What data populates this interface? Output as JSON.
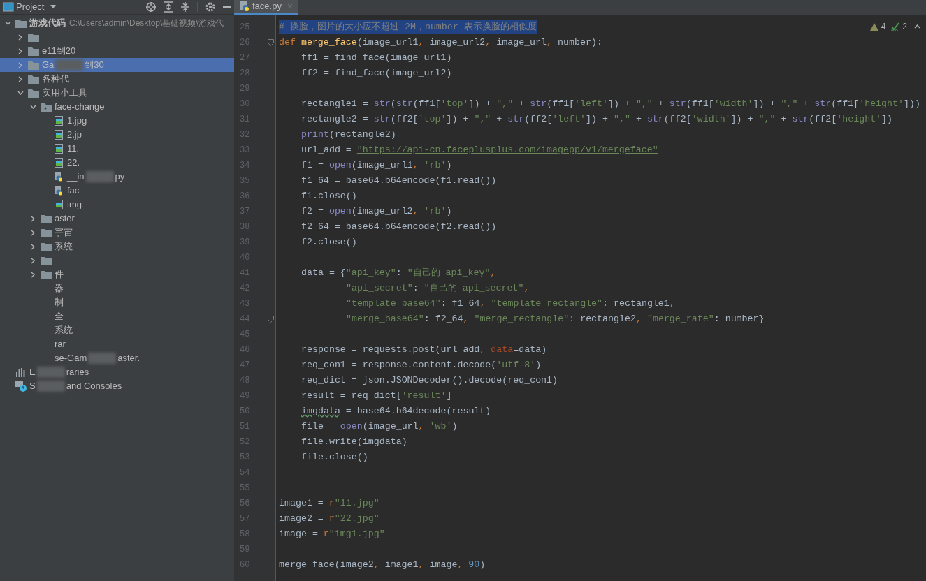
{
  "sidebar": {
    "title": "Project",
    "tree": [
      {
        "kind": "folder",
        "expanded": true,
        "selected": false,
        "parts": [
          "游戏代码"
        ],
        "path": "C:\\Users\\admin\\Desktop\\基础视频\\游戏代",
        "children": [
          {
            "kind": "folder",
            "expanded": false,
            "selected": false
          },
          {
            "kind": "folder",
            "expanded": false,
            "selected": false,
            "parts": [
              "e11到20"
            ]
          },
          {
            "kind": "folder",
            "expanded": false,
            "selected": true,
            "parts": [
              "Ga",
              "到30"
            ]
          },
          {
            "kind": "folder",
            "expanded": false,
            "selected": false,
            "parts": [
              "各种代"
            ]
          },
          {
            "kind": "folder",
            "expanded": true,
            "selected": false,
            "parts": [
              "实用小工具"
            ],
            "children": [
              {
                "kind": "module",
                "expanded": true,
                "selected": false,
                "parts": [
                  "face-change"
                ],
                "children": [
                  {
                    "kind": "image",
                    "selected": false,
                    "parts": [
                      "1.jpg"
                    ]
                  },
                  {
                    "kind": "image",
                    "selected": false,
                    "parts": [
                      "2.jp"
                    ]
                  },
                  {
                    "kind": "image",
                    "selected": false,
                    "parts": [
                      "11."
                    ]
                  },
                  {
                    "kind": "image",
                    "selected": false,
                    "parts": [
                      "22."
                    ]
                  },
                  {
                    "kind": "python",
                    "selected": false,
                    "parts": [
                      "__in",
                      "py"
                    ]
                  },
                  {
                    "kind": "python",
                    "selected": false,
                    "parts": [
                      "fac"
                    ]
                  },
                  {
                    "kind": "image",
                    "selected": false,
                    "parts": [
                      "img"
                    ]
                  }
                ]
              },
              {
                "kind": "folder",
                "expanded": false,
                "selected": false,
                "parts": [
                  "aster"
                ]
              },
              {
                "kind": "folder",
                "expanded": false,
                "selected": false,
                "parts": [
                  "宇宙"
                ]
              },
              {
                "kind": "folder",
                "expanded": false,
                "selected": false,
                "parts": [
                  "系统"
                ]
              },
              {
                "kind": "folder",
                "expanded": false,
                "selected": false
              },
              {
                "kind": "folder",
                "expanded": false,
                "selected": false,
                "parts": [
                  "件"
                ]
              },
              {
                "kind": "plain",
                "selected": false,
                "parts": [
                  "器"
                ]
              },
              {
                "kind": "plain",
                "selected": false,
                "parts": [
                  "制"
                ]
              },
              {
                "kind": "plain",
                "selected": false,
                "parts": [
                  "全"
                ]
              },
              {
                "kind": "plain",
                "selected": false,
                "parts": [
                  "系统"
                ]
              },
              {
                "kind": "plain",
                "selected": false,
                "parts": [
                  "rar"
                ]
              },
              {
                "kind": "plain",
                "selected": false,
                "parts": [
                  "se-Gam",
                  "aster."
                ]
              }
            ]
          }
        ]
      },
      {
        "kind": "libraries",
        "selected": false,
        "parts": [
          "E",
          "raries"
        ]
      },
      {
        "kind": "scratches",
        "selected": false,
        "parts": [
          "S",
          "and Consoles"
        ]
      }
    ]
  },
  "tab": {
    "label": "face.py"
  },
  "inspections": {
    "warnings": "4",
    "typos": "2"
  },
  "code": [
    {
      "number": "25",
      "kind": "top",
      "selected": true,
      "tokens": [
        {
          "kind": "comment",
          "text": "# 换脸，图片的大小应不超过 2M，number 表示换脸的相似度"
        }
      ]
    },
    {
      "number": "26",
      "kind": "top",
      "fold_marker": true,
      "tokens": [
        {
          "kind": "kw",
          "text": "def "
        },
        {
          "kind": "fn",
          "text": "merge_face"
        },
        {
          "kind": "plain",
          "text": "(image_url1"
        },
        {
          "kind": "kw",
          "text": ", "
        },
        {
          "kind": "plain",
          "text": "image_url2"
        },
        {
          "kind": "kw",
          "text": ", "
        },
        {
          "kind": "plain",
          "text": "image_url"
        },
        {
          "kind": "kw",
          "text": ", "
        },
        {
          "kind": "plain",
          "text": "number):"
        }
      ]
    },
    {
      "number": "27",
      "kind": "body",
      "tokens": [
        {
          "kind": "plain",
          "text": "ff1 = find_face(image_url1)"
        }
      ]
    },
    {
      "number": "28",
      "kind": "body",
      "tokens": [
        {
          "kind": "plain",
          "text": "ff2 = find_face(image_url2)"
        }
      ]
    },
    {
      "number": "29",
      "kind": "top"
    },
    {
      "number": "30",
      "kind": "body",
      "tokens": [
        {
          "kind": "plain",
          "text": "rectangle1 = "
        },
        {
          "kind": "builtin",
          "text": "str"
        },
        {
          "kind": "plain",
          "text": "("
        },
        {
          "kind": "builtin",
          "text": "str"
        },
        {
          "kind": "plain",
          "text": "(ff1["
        },
        {
          "kind": "str",
          "text": "'top'"
        },
        {
          "kind": "plain",
          "text": "]) + "
        },
        {
          "kind": "str",
          "text": "\",\""
        },
        {
          "kind": "plain",
          "text": " + "
        },
        {
          "kind": "builtin",
          "text": "str"
        },
        {
          "kind": "plain",
          "text": "(ff1["
        },
        {
          "kind": "str",
          "text": "'left'"
        },
        {
          "kind": "plain",
          "text": "]) + "
        },
        {
          "kind": "str",
          "text": "\",\""
        },
        {
          "kind": "plain",
          "text": " + "
        },
        {
          "kind": "builtin",
          "text": "str"
        },
        {
          "kind": "plain",
          "text": "(ff1["
        },
        {
          "kind": "str",
          "text": "'width'"
        },
        {
          "kind": "plain",
          "text": "]) + "
        },
        {
          "kind": "str",
          "text": "\",\""
        },
        {
          "kind": "plain",
          "text": " + "
        },
        {
          "kind": "builtin",
          "text": "str"
        },
        {
          "kind": "plain",
          "text": "(ff1["
        },
        {
          "kind": "str",
          "text": "'height'"
        },
        {
          "kind": "plain",
          "text": "]))"
        }
      ]
    },
    {
      "number": "31",
      "kind": "body",
      "tokens": [
        {
          "kind": "plain",
          "text": "rectangle2 = "
        },
        {
          "kind": "builtin",
          "text": "str"
        },
        {
          "kind": "plain",
          "text": "(ff2["
        },
        {
          "kind": "str",
          "text": "'top'"
        },
        {
          "kind": "plain",
          "text": "]) + "
        },
        {
          "kind": "str",
          "text": "\",\""
        },
        {
          "kind": "plain",
          "text": " + "
        },
        {
          "kind": "builtin",
          "text": "str"
        },
        {
          "kind": "plain",
          "text": "(ff2["
        },
        {
          "kind": "str",
          "text": "'left'"
        },
        {
          "kind": "plain",
          "text": "]) + "
        },
        {
          "kind": "str",
          "text": "\",\""
        },
        {
          "kind": "plain",
          "text": " + "
        },
        {
          "kind": "builtin",
          "text": "str"
        },
        {
          "kind": "plain",
          "text": "(ff2["
        },
        {
          "kind": "str",
          "text": "'width'"
        },
        {
          "kind": "plain",
          "text": "]) + "
        },
        {
          "kind": "str",
          "text": "\",\""
        },
        {
          "kind": "plain",
          "text": " + "
        },
        {
          "kind": "builtin",
          "text": "str"
        },
        {
          "kind": "plain",
          "text": "(ff2["
        },
        {
          "kind": "str",
          "text": "'height'"
        },
        {
          "kind": "plain",
          "text": "])"
        }
      ]
    },
    {
      "number": "32",
      "kind": "body",
      "tokens": [
        {
          "kind": "builtin",
          "text": "print"
        },
        {
          "kind": "plain",
          "text": "(rectangle2)"
        }
      ]
    },
    {
      "number": "33",
      "kind": "body",
      "tokens": [
        {
          "kind": "plain",
          "text": "url_add = "
        },
        {
          "kind": "url",
          "text": "\"https://api-cn.faceplusplus.com/imagepp/v1/mergeface\""
        }
      ]
    },
    {
      "number": "34",
      "kind": "body",
      "tokens": [
        {
          "kind": "plain",
          "text": "f1 = "
        },
        {
          "kind": "builtin",
          "text": "open"
        },
        {
          "kind": "plain",
          "text": "(image_url1"
        },
        {
          "kind": "kw",
          "text": ", "
        },
        {
          "kind": "str",
          "text": "'rb'"
        },
        {
          "kind": "plain",
          "text": ")"
        }
      ]
    },
    {
      "number": "35",
      "kind": "body",
      "tokens": [
        {
          "kind": "plain",
          "text": "f1_64 = base64.b64encode(f1.read())"
        }
      ]
    },
    {
      "number": "36",
      "kind": "body",
      "tokens": [
        {
          "kind": "plain",
          "text": "f1.close()"
        }
      ]
    },
    {
      "number": "37",
      "kind": "body",
      "tokens": [
        {
          "kind": "plain",
          "text": "f2 = "
        },
        {
          "kind": "builtin",
          "text": "open"
        },
        {
          "kind": "plain",
          "text": "(image_url2"
        },
        {
          "kind": "kw",
          "text": ", "
        },
        {
          "kind": "str",
          "text": "'rb'"
        },
        {
          "kind": "plain",
          "text": ")"
        }
      ]
    },
    {
      "number": "38",
      "kind": "body",
      "tokens": [
        {
          "kind": "plain",
          "text": "f2_64 = base64.b64encode(f2.read())"
        }
      ]
    },
    {
      "number": "39",
      "kind": "body",
      "tokens": [
        {
          "kind": "plain",
          "text": "f2.close()"
        }
      ]
    },
    {
      "number": "40",
      "kind": "top"
    },
    {
      "number": "41",
      "kind": "body",
      "tokens": [
        {
          "kind": "plain",
          "text": "data = {"
        },
        {
          "kind": "str",
          "text": "\"api_key\""
        },
        {
          "kind": "plain",
          "text": ": "
        },
        {
          "kind": "str",
          "text": "\"自己的 api_key\""
        },
        {
          "kind": "kw",
          "text": ","
        }
      ]
    },
    {
      "number": "42",
      "kind": "cont",
      "tokens": [
        {
          "kind": "str",
          "text": "\"api_secret\""
        },
        {
          "kind": "plain",
          "text": ": "
        },
        {
          "kind": "str",
          "text": "\"自己的 api_secret\""
        },
        {
          "kind": "kw",
          "text": ","
        }
      ]
    },
    {
      "number": "43",
      "kind": "cont",
      "tokens": [
        {
          "kind": "str",
          "text": "\"template_base64\""
        },
        {
          "kind": "plain",
          "text": ": f1_64"
        },
        {
          "kind": "kw",
          "text": ", "
        },
        {
          "kind": "str",
          "text": "\"template_rectangle\""
        },
        {
          "kind": "plain",
          "text": ": rectangle1"
        },
        {
          "kind": "kw",
          "text": ","
        }
      ]
    },
    {
      "number": "44",
      "kind": "cont",
      "fold_marker": true,
      "tokens": [
        {
          "kind": "str",
          "text": "\"merge_base64\""
        },
        {
          "kind": "plain",
          "text": ": f2_64"
        },
        {
          "kind": "kw",
          "text": ", "
        },
        {
          "kind": "str",
          "text": "\"merge_rectangle\""
        },
        {
          "kind": "plain",
          "text": ": rectangle2"
        },
        {
          "kind": "kw",
          "text": ", "
        },
        {
          "kind": "str",
          "text": "\"merge_rate\""
        },
        {
          "kind": "plain",
          "text": ": number}"
        }
      ]
    },
    {
      "number": "45",
      "kind": "top"
    },
    {
      "number": "46",
      "kind": "body",
      "tokens": [
        {
          "kind": "plain",
          "text": "response = requests.post(url_add"
        },
        {
          "kind": "kw",
          "text": ", "
        },
        {
          "kind": "param",
          "text": "data"
        },
        {
          "kind": "plain",
          "text": "=data)"
        }
      ]
    },
    {
      "number": "47",
      "kind": "body",
      "tokens": [
        {
          "kind": "plain",
          "text": "req_con1 = response.content.decode("
        },
        {
          "kind": "str",
          "text": "'utf-8'"
        },
        {
          "kind": "plain",
          "text": ")"
        }
      ]
    },
    {
      "number": "48",
      "kind": "body",
      "tokens": [
        {
          "kind": "plain",
          "text": "req_dict = json.JSONDecoder().decode(req_con1)"
        }
      ]
    },
    {
      "number": "49",
      "kind": "body",
      "tokens": [
        {
          "kind": "plain",
          "text": "result = req_dict["
        },
        {
          "kind": "str",
          "text": "'result'"
        },
        {
          "kind": "plain",
          "text": "]"
        }
      ]
    },
    {
      "number": "50",
      "kind": "body",
      "tokens": [
        {
          "kind": "typo",
          "text": "imgdata"
        },
        {
          "kind": "plain",
          "text": " = base64.b64decode(result)"
        }
      ]
    },
    {
      "number": "51",
      "kind": "body",
      "tokens": [
        {
          "kind": "plain",
          "text": "file = "
        },
        {
          "kind": "builtin",
          "text": "open"
        },
        {
          "kind": "plain",
          "text": "(image_url"
        },
        {
          "kind": "kw",
          "text": ", "
        },
        {
          "kind": "str",
          "text": "'wb'"
        },
        {
          "kind": "plain",
          "text": ")"
        }
      ]
    },
    {
      "number": "52",
      "kind": "body",
      "tokens": [
        {
          "kind": "plain",
          "text": "file.write(imgdata)"
        }
      ]
    },
    {
      "number": "53",
      "kind": "body",
      "tokens": [
        {
          "kind": "plain",
          "text": "file.close()"
        }
      ]
    },
    {
      "number": "54",
      "kind": "top"
    },
    {
      "number": "55",
      "kind": "top"
    },
    {
      "number": "56",
      "kind": "top",
      "tokens": [
        {
          "kind": "plain",
          "text": "image1 = "
        },
        {
          "kind": "kw",
          "text": "r"
        },
        {
          "kind": "str",
          "text": "\"11.jpg\""
        }
      ]
    },
    {
      "number": "57",
      "kind": "top",
      "tokens": [
        {
          "kind": "plain",
          "text": "image2 = "
        },
        {
          "kind": "kw",
          "text": "r"
        },
        {
          "kind": "str",
          "text": "\"22.jpg\""
        }
      ]
    },
    {
      "number": "58",
      "kind": "top",
      "tokens": [
        {
          "kind": "plain",
          "text": "image = "
        },
        {
          "kind": "kw",
          "text": "r"
        },
        {
          "kind": "str",
          "text": "\"img1.jpg\""
        }
      ]
    },
    {
      "number": "59",
      "kind": "top"
    },
    {
      "number": "60",
      "kind": "top",
      "tokens": [
        {
          "kind": "plain",
          "text": "merge_face(image2"
        },
        {
          "kind": "kw",
          "text": ", "
        },
        {
          "kind": "plain",
          "text": "image1"
        },
        {
          "kind": "kw",
          "text": ", "
        },
        {
          "kind": "plain",
          "text": "image"
        },
        {
          "kind": "kw",
          "text": ", "
        },
        {
          "kind": "num",
          "text": "90"
        },
        {
          "kind": "plain",
          "text": ")"
        }
      ]
    }
  ]
}
